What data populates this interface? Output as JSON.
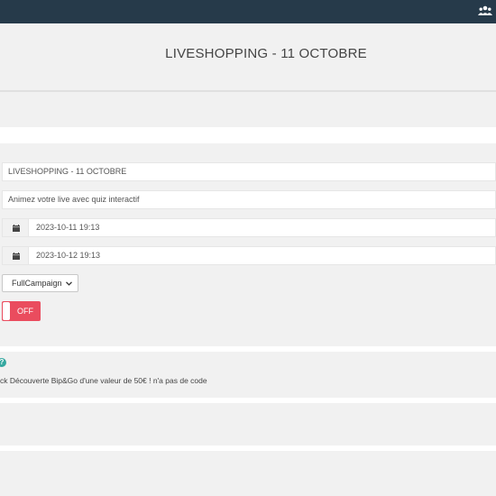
{
  "header": {
    "title": "LIVESHOPPING - 11 OCTOBRE"
  },
  "form": {
    "name_value": "LIVESHOPPING - 11 OCTOBRE",
    "description_value": "Animez votre live avec quiz interactif",
    "start_date": "2023-10-11 19:13",
    "end_date": "2023-10-12 19:13",
    "campaign_type": "FullCampaign",
    "toggle_label": "OFF"
  },
  "info": {
    "help_glyph": "?",
    "message": "ck Découverte Bip&Go d'une valeur de 50€ ! n'a pas de code"
  },
  "icons": {
    "users": "users-icon",
    "calendar": "calendar-icon",
    "chevron": "chevron-down-icon",
    "help": "question-circle-icon"
  },
  "colors": {
    "topbar": "#263a4a",
    "toggle_off": "#ea4c5e",
    "help": "#35a8a0"
  }
}
